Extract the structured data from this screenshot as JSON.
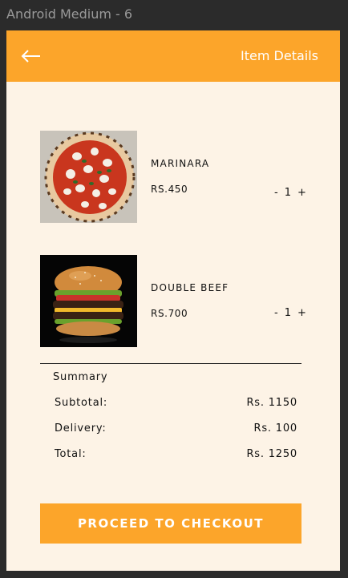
{
  "frame": {
    "label": "Android Medium - 6"
  },
  "appbar": {
    "title": "Item Details",
    "back_icon": "arrow-left-icon"
  },
  "colors": {
    "accent": "#fca52a",
    "background": "#fdf3e6"
  },
  "items": [
    {
      "name": "MARINARA",
      "price": "RS.450",
      "qty": {
        "minus": "-",
        "value": "1",
        "plus": "+"
      }
    },
    {
      "name": "DOUBLE BEEF",
      "price": "RS.700",
      "qty": {
        "minus": "-",
        "value": "1",
        "plus": "+"
      }
    }
  ],
  "summary": {
    "title": "Summary",
    "subtotal_label": "Subtotal:",
    "subtotal_value": "Rs. 1150",
    "delivery_label": "Delivery:",
    "delivery_value": "Rs. 100",
    "total_label": "Total:",
    "total_value": "Rs. 1250"
  },
  "checkout": {
    "label": "PROCEED TO CHECKOUT"
  }
}
